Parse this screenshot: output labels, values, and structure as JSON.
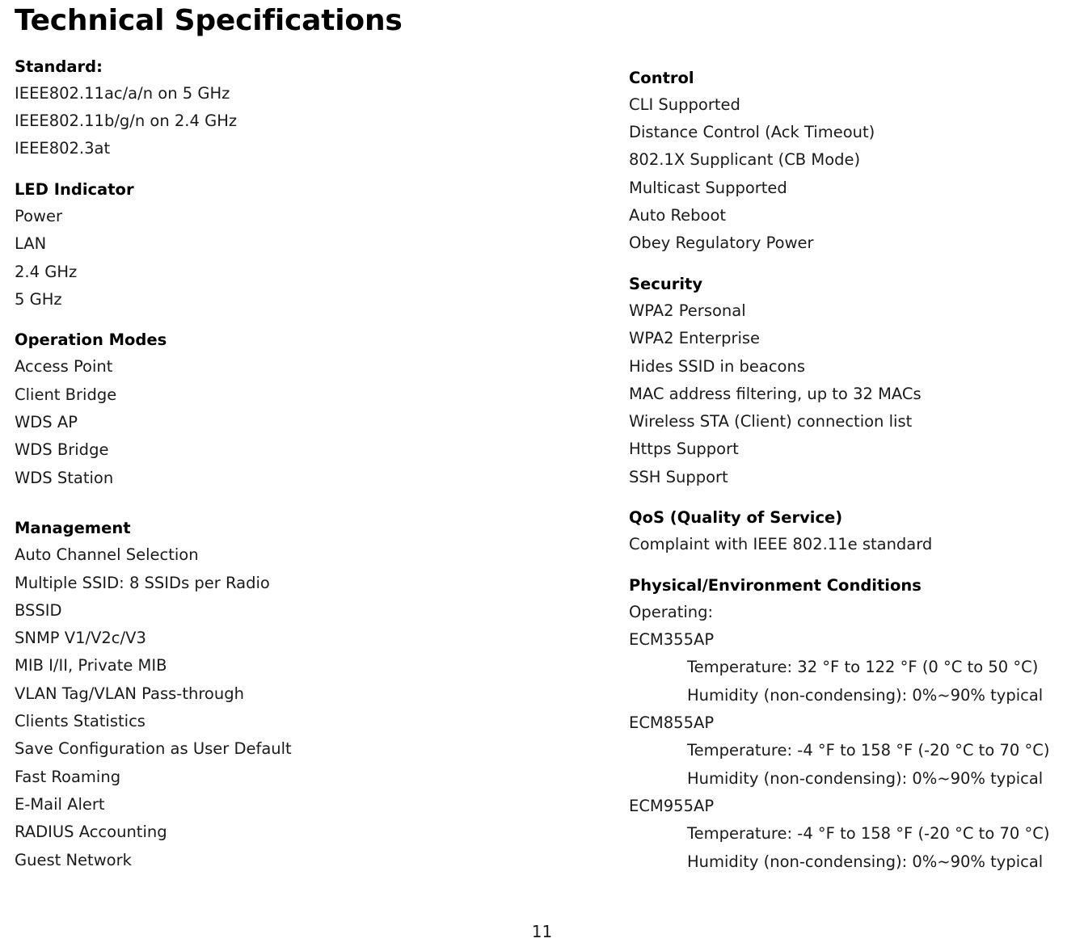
{
  "document": {
    "title": "Technical Specifications",
    "page_number": "11"
  },
  "left_column": [
    {
      "heading": "Standard:",
      "lines": [
        "IEEE802.11ac/a/n on 5 GHz",
        "IEEE802.11b/g/n on 2.4 GHz",
        "IEEE802.3at"
      ]
    },
    {
      "heading": "LED Indicator",
      "lines": [
        "Power",
        "LAN",
        "2.4 GHz",
        "5 GHz"
      ]
    },
    {
      "heading": "Operation Modes",
      "lines": [
        "Access Point",
        "Client Bridge",
        "WDS AP",
        "WDS Bridge",
        "WDS Station"
      ]
    },
    {
      "heading": "Management",
      "lines": [
        "Auto Channel Selection",
        "Multiple SSID: 8 SSIDs per Radio",
        "BSSID",
        "SNMP V1/V2c/V3",
        "MIB I/II, Private MIB",
        "VLAN Tag/VLAN Pass-through",
        "Clients Statistics",
        "Save Configuration as User Default",
        "Fast Roaming",
        "E-Mail Alert",
        "RADIUS Accounting",
        "Guest Network"
      ]
    }
  ],
  "right_column": [
    {
      "heading": "Control",
      "lines": [
        "CLI Supported",
        "Distance Control (Ack Timeout)",
        "802.1X Supplicant (CB Mode)",
        "Multicast Supported",
        "Auto Reboot",
        "Obey Regulatory Power"
      ]
    },
    {
      "heading": "Security",
      "lines": [
        "WPA2 Personal",
        "WPA2 Enterprise",
        "Hides SSID in beacons",
        "MAC address filtering, up to 32 MACs",
        "Wireless STA (Client) connection list",
        "Https Support",
        "SSH Support"
      ]
    },
    {
      "heading": "QoS (Quality of Service)",
      "lines": [
        "Complaint with IEEE 802.11e standard"
      ]
    },
    {
      "heading": "Physical/Environment Conditions",
      "lines": [
        "Operating:",
        "ECM355AP",
        "Temperature: 32 °F to 122 °F (0 °C to 50 °C)",
        "Humidity (non-condensing): 0%~90% typical",
        "ECM855AP",
        "Temperature: -4 °F to 158 °F (-20 °C to 70 °C)",
        "Humidity (non-condensing): 0%~90% typical",
        "ECM955AP",
        "Temperature: -4 °F to 158 °F (-20 °C to 70 °C)",
        "Humidity (non-condensing): 0%~90% typical"
      ],
      "indent_flags": [
        false,
        false,
        true,
        true,
        false,
        true,
        true,
        false,
        true,
        true
      ]
    }
  ]
}
